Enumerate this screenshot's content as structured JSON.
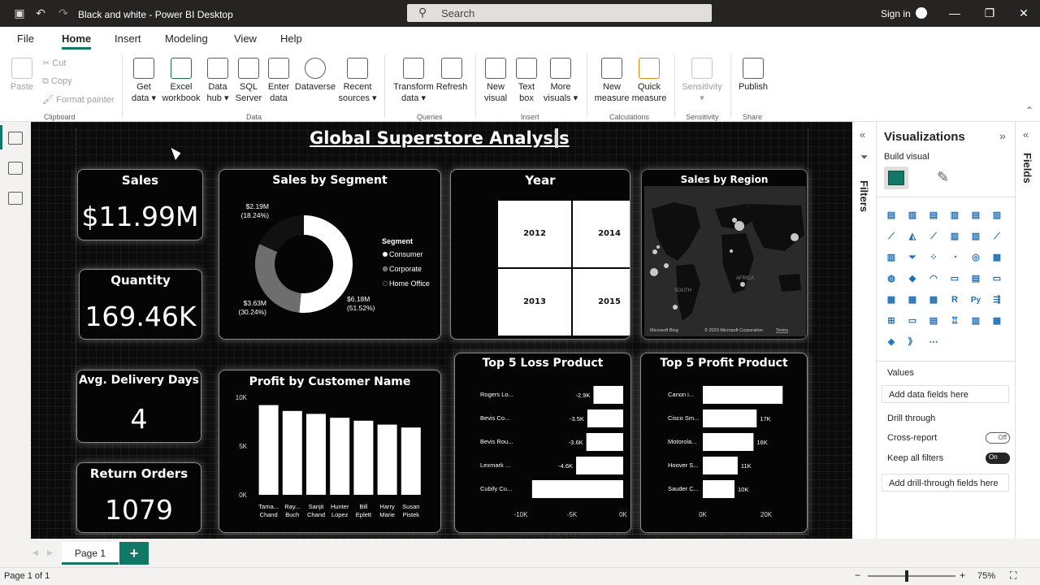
{
  "window": {
    "title": "Black and white - Power BI Desktop",
    "search_placeholder": "Search",
    "signin": "Sign in"
  },
  "menu": [
    "File",
    "Home",
    "Insert",
    "Modeling",
    "View",
    "Help"
  ],
  "ribbon": {
    "clipboard": {
      "paste": "Paste",
      "cut": "Cut",
      "copy": "Copy",
      "format_painter": "Format painter",
      "group": "Clipboard"
    },
    "data": {
      "get_data": [
        "Get",
        "data ▾"
      ],
      "excel": [
        "Excel",
        "workbook"
      ],
      "data_hub": [
        "Data",
        "hub ▾"
      ],
      "sql": [
        "SQL",
        "Server"
      ],
      "enter": [
        "Enter",
        "data"
      ],
      "dataverse": [
        "Dataverse"
      ],
      "recent": [
        "Recent",
        "sources ▾"
      ],
      "group": "Data"
    },
    "queries": {
      "transform": [
        "Transform",
        "data ▾"
      ],
      "refresh": [
        "Refresh"
      ],
      "group": "Queries"
    },
    "insert": {
      "new_visual": [
        "New",
        "visual"
      ],
      "text_box": [
        "Text",
        "box"
      ],
      "more_visuals": [
        "More",
        "visuals ▾"
      ],
      "group": "Insert"
    },
    "calculations": {
      "new_measure": [
        "New",
        "measure"
      ],
      "quick_measure": [
        "Quick",
        "measure"
      ],
      "group": "Calculations"
    },
    "sensitivity": {
      "label": [
        "Sensitivity",
        "▾"
      ],
      "group": "Sensitivity"
    },
    "share": {
      "publish": [
        "Publish"
      ],
      "group": "Share"
    }
  },
  "report": {
    "title": "Global Superstore Analysis",
    "kpis": {
      "sales": {
        "title": "Sales",
        "value": "$11.99M"
      },
      "quantity": {
        "title": "Quantity",
        "value": "169.46K"
      },
      "delivery": {
        "title": "Avg. Delivery Days",
        "value": "4"
      },
      "returns": {
        "title": "Return Orders",
        "value": "1079"
      }
    },
    "segment": {
      "title": "Sales by Segment",
      "legend_title": "Segment",
      "slices": [
        {
          "name": "Consumer",
          "value": 6.18,
          "label": "$6.18M",
          "pct": "(51.52%)",
          "color": "#ffffff"
        },
        {
          "name": "Corporate",
          "value": 3.63,
          "label": "$3.63M",
          "pct": "(30.24%)",
          "color": "#6e6e6e"
        },
        {
          "name": "Home Office",
          "value": 2.19,
          "label": "$2.19M",
          "pct": "(18.24%)",
          "color": "#111111"
        }
      ]
    },
    "year": {
      "title": "Year",
      "tiles": [
        "2012",
        "2014",
        "2013",
        "2015"
      ]
    },
    "region": {
      "title": "Sales by Region",
      "labels": [
        "SOUTH",
        "AFRICA"
      ],
      "bing": "Microsoft Bing",
      "copyright": "© 2023 Microsoft Corporation",
      "terms": "Terms"
    },
    "profit_customer": {
      "title": "Profit by Customer Name",
      "ticks": [
        "10K",
        "5K",
        "0K"
      ],
      "bars": [
        {
          "name": [
            "Tama...",
            "Chand"
          ],
          "value": 9.2
        },
        {
          "name": [
            "Ray...",
            "Buch"
          ],
          "value": 8.6
        },
        {
          "name": [
            "Sanjit",
            "Chand"
          ],
          "value": 8.3
        },
        {
          "name": [
            "Hunter",
            "Lopez"
          ],
          "value": 7.9
        },
        {
          "name": [
            "Bill",
            "Eplett"
          ],
          "value": 7.6
        },
        {
          "name": [
            "Harry",
            "Marie"
          ],
          "value": 7.2
        },
        {
          "name": [
            "Susan",
            "Pistek"
          ],
          "value": 6.9
        }
      ]
    },
    "loss": {
      "title": "Top 5 Loss Product",
      "ticks": [
        "-10K",
        "-5K",
        "0K"
      ],
      "bars": [
        {
          "name": "Rogers Lo...",
          "value": -2.9,
          "label": "-2.9K"
        },
        {
          "name": "Bevis Co...",
          "value": -3.5,
          "label": "-3.5K"
        },
        {
          "name": "Bevis Rou...",
          "value": -3.6,
          "label": "-3.6K"
        },
        {
          "name": "Lexmark ...",
          "value": -4.6,
          "label": "-4.6K"
        },
        {
          "name": "Cubify Cu...",
          "value": -8.9,
          "label": ""
        }
      ]
    },
    "profit_product": {
      "title": "Top 5 Profit Product",
      "ticks": [
        "0K",
        "20K"
      ],
      "bars": [
        {
          "name": "Canon i...",
          "value": 25.2,
          "label": ""
        },
        {
          "name": "Cisco Sm...",
          "value": 17,
          "label": "17K"
        },
        {
          "name": "Motorola...",
          "value": 16,
          "label": "16K"
        },
        {
          "name": "Hoover S...",
          "value": 11,
          "label": "11K"
        },
        {
          "name": "Sauder C...",
          "value": 10,
          "label": "10K"
        }
      ]
    }
  },
  "panes": {
    "filters": "Filters",
    "visualizations": "Visualizations",
    "build_visual": "Build visual",
    "values": "Values",
    "add_data_fields": "Add data fields here",
    "drill_through": "Drill through",
    "cross_report": "Cross-report",
    "cross_report_state": "Off",
    "keep_all_filters": "Keep all filters",
    "keep_all_filters_state": "On",
    "add_drill_fields": "Add drill-through fields here",
    "fields": "Fields",
    "viz_icons": [
      "▤",
      "▥",
      "▤",
      "▥",
      "▤",
      "▥",
      "⟋",
      "◭",
      "⟋",
      "▥",
      "▥",
      "⟋",
      "▥",
      "⏷",
      "⁘",
      "◔",
      "◎",
      "▦",
      "◍",
      "◆",
      "◠",
      "▭",
      "▤",
      "▭",
      "▦",
      "▦",
      "▦",
      "R",
      "Py",
      "⇶",
      "⊞",
      "▭",
      "▤",
      "♖",
      "▥",
      "▦",
      "◈",
      "》",
      "⋯"
    ]
  },
  "bottom": {
    "page_tab": "Page 1",
    "add_page": "+",
    "status": "Page 1 of 1",
    "zoom": "75%"
  }
}
